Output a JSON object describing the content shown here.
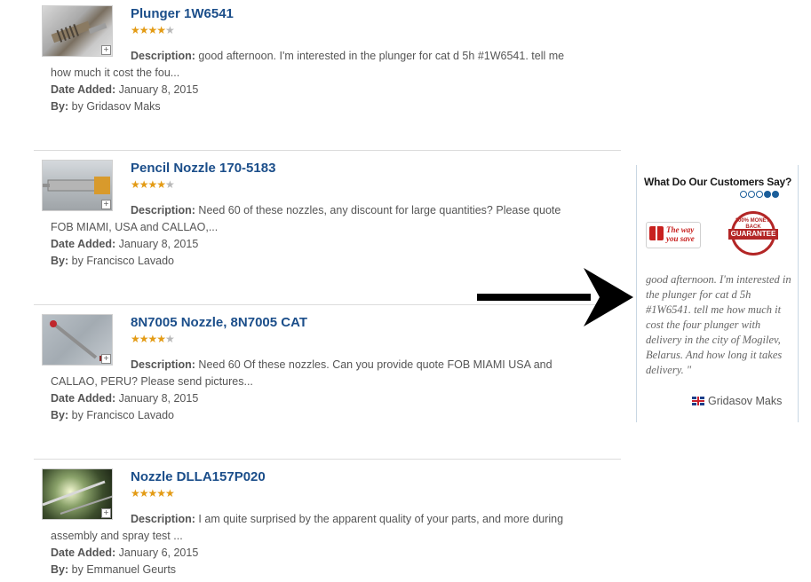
{
  "reviews": [
    {
      "title": "Plunger 1W6541",
      "rating": 4,
      "description_label": "Description:",
      "description": "good afternoon. I'm interested in the plunger for cat d 5h #1W6541. tell me how much it cost the fou...",
      "date_label": "Date Added:",
      "date": "January 8, 2015",
      "by_label": "By:",
      "by": "by Gridasov Maks",
      "thumb_icon": "plunger-photo"
    },
    {
      "title": "Pencil Nozzle 170-5183",
      "rating": 4,
      "description_label": "Description:",
      "description": "Need 60 of these nozzles, any discount for large quantities? Please quote FOB MIAMI, USA and CALLAO,...",
      "date_label": "Date Added:",
      "date": "January 8, 2015",
      "by_label": "By:",
      "by": "by Francisco Lavado",
      "thumb_icon": "pencil-nozzle-photo"
    },
    {
      "title": "8N7005 Nozzle, 8N7005 CAT",
      "rating": 4,
      "description_label": "Description:",
      "description": "Need 60 Of these nozzles. Can you provide quote FOB MIAMI USA and CALLAO, PERU? Please send pictures...",
      "date_label": "Date Added:",
      "date": "January 8, 2015",
      "by_label": "By:",
      "by": "by Francisco Lavado",
      "thumb_icon": "nozzle-photo"
    },
    {
      "title": "Nozzle DLLA157P020",
      "rating": 5,
      "description_label": "Description:",
      "description": "I am quite surprised by the apparent quality of your parts, and more during assembly and spray test ...",
      "date_label": "Date Added:",
      "date": "January 6, 2015",
      "by_label": "By:",
      "by": "by Emmanuel Geurts",
      "thumb_icon": "nozzle-closeup-photo"
    }
  ],
  "testimonial": {
    "heading": "What Do Our Customers Say?",
    "active_dot": 4,
    "dot_count": 5,
    "badge_way_line1": "The way",
    "badge_way_line2": "you save",
    "badge_mb_top": "100% MONEY-BACK",
    "badge_mb_band": "GUARANTEE",
    "quote": "good afternoon. I'm interested in the plunger for cat d 5h #1W6541. tell me how much it cost the four plunger with delivery in the city of Mogilev, Belarus. And how long it takes delivery. \"",
    "author": "Gridasov Maks",
    "author_flag": "uk-flag-icon"
  },
  "colors": {
    "title": "#1b4e8a",
    "star_on": "#e39b15",
    "star_off": "#b8b8b8",
    "badge_red": "#b32626",
    "dot_blue": "#1b5e9a"
  }
}
